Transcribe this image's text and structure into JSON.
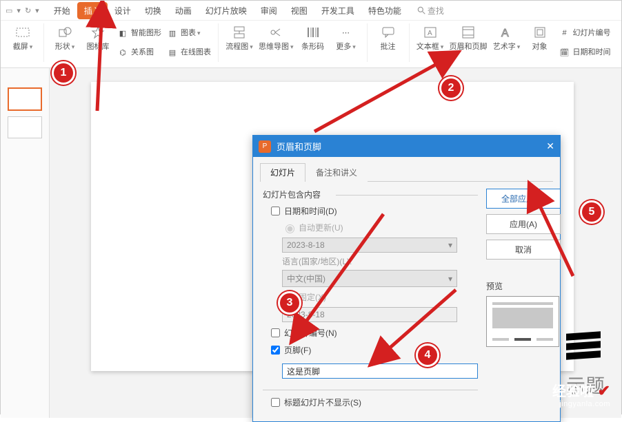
{
  "tabs": {
    "start": "开始",
    "insert": "插入",
    "design": "设计",
    "transition": "切换",
    "animation": "动画",
    "slideshow": "幻灯片放映",
    "review": "审阅",
    "view": "视图",
    "devtools": "开发工具",
    "special": "特色功能",
    "search": "查找"
  },
  "ribbon": {
    "screenshot": "截屏",
    "shape": "形状",
    "iconlib": "图标库",
    "smartart": "智能图形",
    "chart": "图表",
    "relation": "关系图",
    "onlinechart": "在线图表",
    "flowchart": "流程图",
    "mindmap": "思维导图",
    "barcode": "条形码",
    "more": "更多",
    "comment": "批注",
    "textbox": "文本框",
    "headerfooter": "页眉和页脚",
    "wordart": "艺术字",
    "object": "对象",
    "slidenumber": "幻灯片编号",
    "datetime": "日期和时间"
  },
  "dialog": {
    "title": "页眉和页脚",
    "tab_slide": "幻灯片",
    "tab_notes": "备注和讲义",
    "section_label": "幻灯片包含内容",
    "cb_datetime": "日期和时间(D)",
    "rb_auto": "自动更新(U)",
    "date_value": "2023-8-18",
    "lang_label": "语言(国家/地区)(L):",
    "lang_value": "中文(中国)",
    "rb_fixed": "固定(X)",
    "fixed_value": "2023-8-18",
    "cb_slidenum": "幻灯片编号(N)",
    "cb_footer": "页脚(F)",
    "footer_text": "这是页脚",
    "cb_hidetitle": "标题幻灯片不显示(S)",
    "btn_applyall": "全部应用(Y)",
    "btn_apply": "应用(A)",
    "btn_cancel": "取消",
    "preview_label": "预览"
  },
  "placeholder_title": "示题",
  "watermark": {
    "brand": "经验啦",
    "url": "jingyanla.com"
  },
  "annotations": {
    "n1": "1",
    "n2": "2",
    "n3": "3",
    "n4": "4",
    "n5": "5"
  }
}
